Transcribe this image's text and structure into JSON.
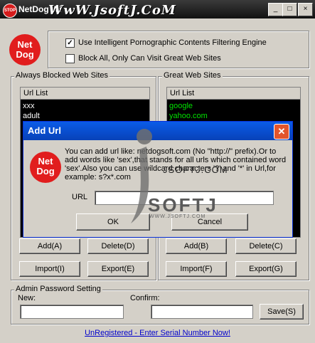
{
  "window": {
    "title": "NetDog Wi",
    "watermark": "WwW.JsoftJ.CoM",
    "controls": {
      "minimize": "_",
      "maximize": "□",
      "close": "×"
    }
  },
  "logo": {
    "line1": "Net",
    "line2": "Dog"
  },
  "options": [
    {
      "label": "Use Intelligent Pornographic Contents Filtering Engine",
      "checked": true
    },
    {
      "label": "Block All, Only Can Visit Great Web Sites",
      "checked": false
    }
  ],
  "blocked": {
    "title": "Always Blocked Web Sites",
    "header": "Url List",
    "items": [
      "xxx",
      "adult"
    ],
    "add": "Add(A)",
    "delete": "Delete(D)",
    "import": "Import(I)",
    "export": "Export(E)"
  },
  "great": {
    "title": "Great Web Sites",
    "header": "Url List",
    "items": [
      "google",
      "yahoo.com"
    ],
    "add": "Add(B)",
    "delete": "Delete(C)",
    "import": "Import(F)",
    "export": "Export(G)"
  },
  "password": {
    "title": "Admin Password Setting",
    "new_label": "New:",
    "confirm_label": "Confirm:",
    "new_value": "",
    "confirm_value": "",
    "save": "Save(S)"
  },
  "status": {
    "link": "UnRegistered - Enter Serial Number Now!"
  },
  "dialog": {
    "title": "Add Url",
    "message": "You can add url like: netdogsoft.com (No \"http://\" prefix).Or to add words like 'sex',that stands for all urls which contained word 'sex'.Also you can use wildcard characters '?' and '*' in Url,for example: s?x*.com",
    "url_label": "URL",
    "url_value": "",
    "ok": "OK",
    "cancel": "Cancel",
    "watermark_mid": "JSOFTJ.COM",
    "watermark": "SOFTJ",
    "watermark_sub": "WWW.JSOFTJ.COM"
  },
  "colors": {
    "titlebar": "#111111",
    "dialog_titlebar": "#0a5ce8",
    "logo_red": "#e11d1d",
    "blocked_text": "#ffffff",
    "great_text": "#00e000",
    "link": "#0000cc"
  }
}
